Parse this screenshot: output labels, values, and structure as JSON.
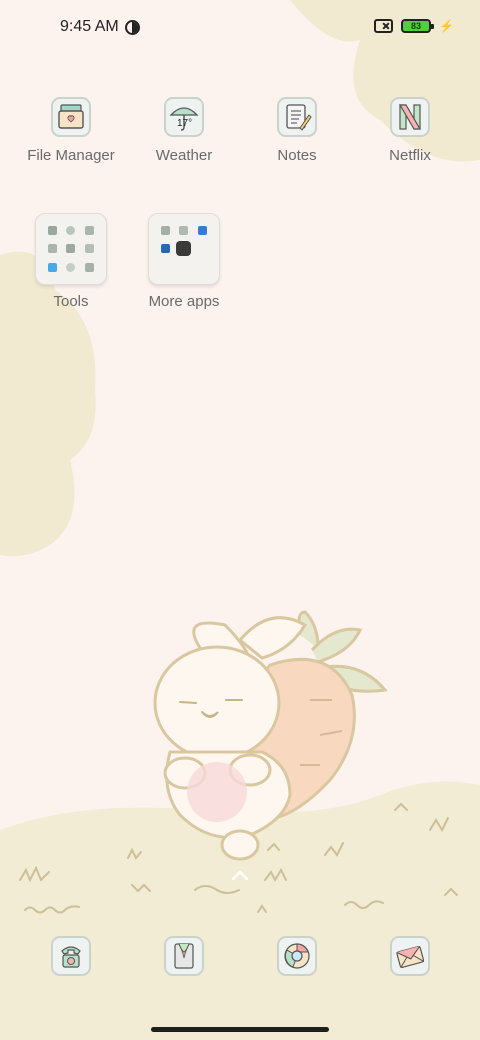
{
  "status_bar": {
    "time": "9:45 AM",
    "battery_level": "83",
    "icons": [
      "dnd-moon-icon",
      "no-sim-icon",
      "battery-icon",
      "charging-bolt-icon"
    ]
  },
  "home_apps": [
    {
      "label": "File Manager",
      "icon": "file-manager-icon"
    },
    {
      "label": "Weather",
      "icon": "umbrella-weather-icon",
      "badge": "17°"
    },
    {
      "label": "Notes",
      "icon": "notepad-pencil-icon"
    },
    {
      "label": "Netflix",
      "icon": "netflix-n-icon"
    }
  ],
  "folders": [
    {
      "label": "Tools"
    },
    {
      "label": "More apps"
    }
  ],
  "dock": [
    {
      "icon": "phone-icon",
      "name": "Phone"
    },
    {
      "icon": "contacts-icon",
      "name": "Contacts"
    },
    {
      "icon": "chrome-icon",
      "name": "Chrome"
    },
    {
      "icon": "messages-icon",
      "name": "Messages"
    }
  ],
  "colors": {
    "background": "#fdf3ee",
    "blob": "#f1ead0",
    "grass": "#f1ecd3",
    "carrot": "#f9d8c0",
    "bunny_outline": "#d9c7a0",
    "leaf": "#e3e8cf"
  }
}
